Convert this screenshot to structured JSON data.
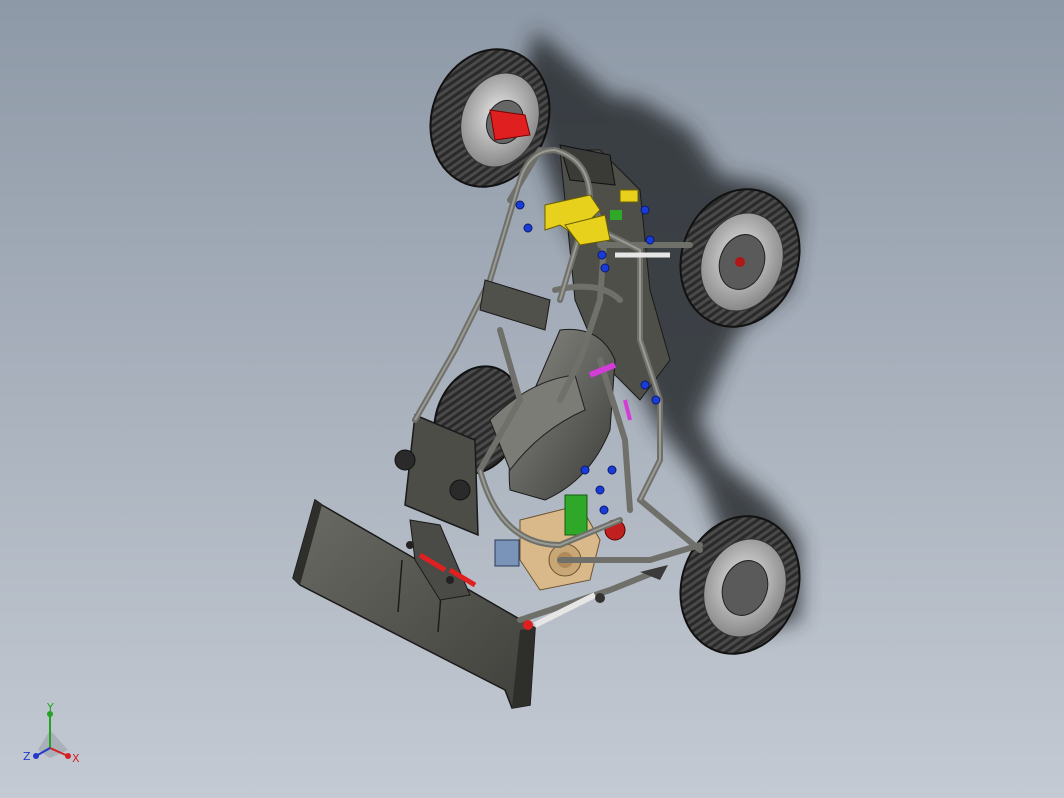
{
  "viewport": {
    "background_top": "#8e99a7",
    "background_bottom": "#c4cad3"
  },
  "model": {
    "frame_color": "#595a54",
    "tire_color": "#2b2b2b",
    "rim_color": "#cfcfcf",
    "highlight_red": "#e02020",
    "highlight_yellow": "#e8d11c",
    "highlight_green": "#2fa82a",
    "highlight_blue": "#1a3cd6",
    "highlight_magenta": "#d33cd6",
    "engine_color": "#d9b98a"
  },
  "triad": {
    "x_label": "X",
    "y_label": "Y",
    "z_label": "Z",
    "x_color": "#d42020",
    "y_color": "#23a323",
    "z_color": "#2438c9"
  }
}
